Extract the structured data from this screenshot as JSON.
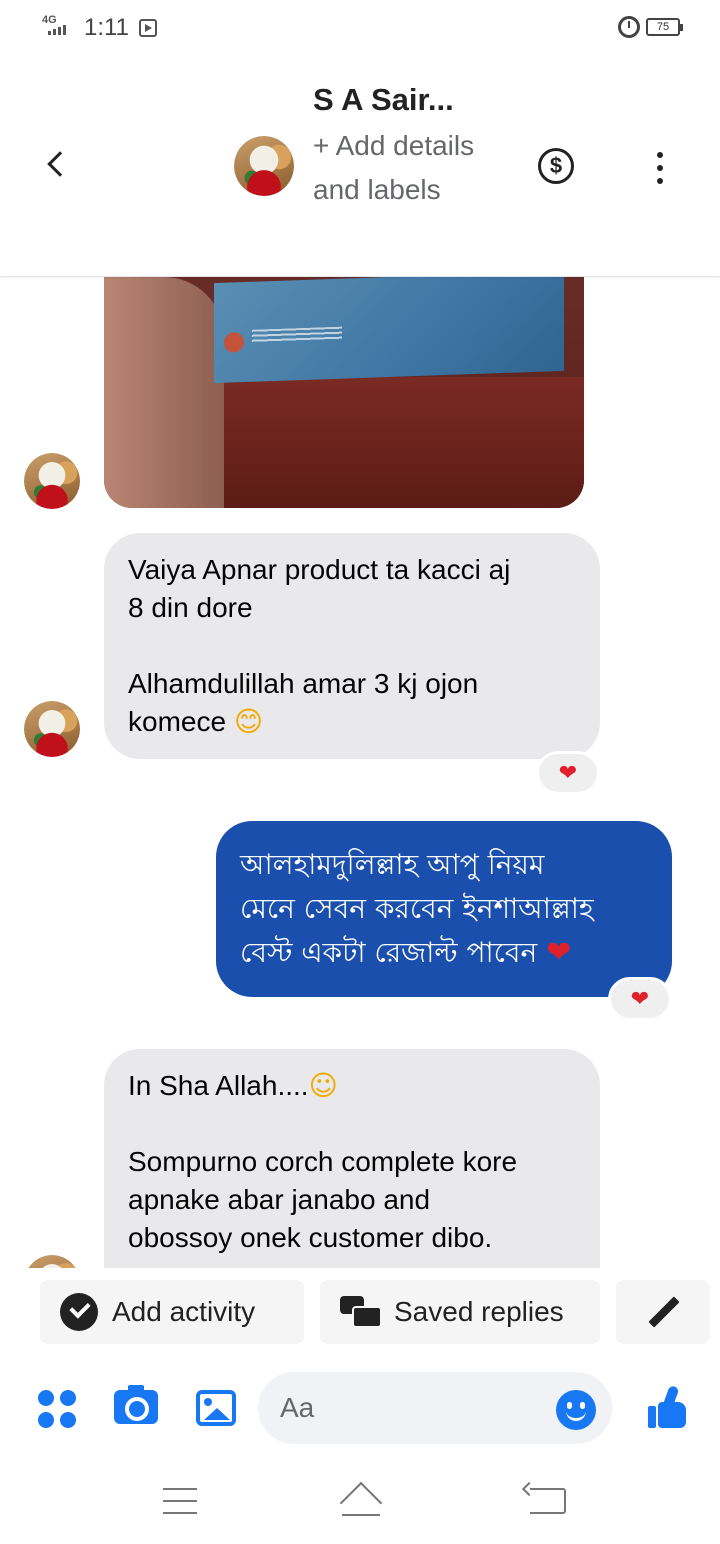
{
  "status_bar": {
    "network": "4G",
    "time": "1:11",
    "battery": "75"
  },
  "header": {
    "title": "S A Sair...",
    "subtitle": "+ Add details and labels"
  },
  "messages": [
    {
      "direction": "incoming",
      "lines": [
        "Vaiya Apnar product ta kacci aj",
        "8 din dore",
        "",
        "Alhamdulillah  amar 3 kj ojon",
        "komece"
      ],
      "emoji": "😊",
      "reaction": "❤"
    },
    {
      "direction": "outgoing",
      "lines": [
        "আলহামদুলিল্লাহ আপু নিয়ম",
        "মেনে সেবন করবেন ইনশাআল্লাহ",
        "বেস্ট একটা রেজাল্ট পাবেন"
      ],
      "emoji": "❤",
      "reaction": "❤"
    },
    {
      "direction": "incoming",
      "lines": [
        "In Sha Allah....",
        "",
        "Sompurno corch complete kore",
        "apnake abar janabo and",
        "obossoy  onek customer dibo."
      ],
      "emoji": "☺"
    }
  ],
  "quick_actions": {
    "add_activity": "Add activity",
    "saved_replies": "Saved replies"
  },
  "composer": {
    "placeholder": "Aa"
  },
  "colors": {
    "accent": "#1877f2",
    "outgoing_bubble": "#1b4fae",
    "incoming_bubble": "#e9e9eb"
  }
}
